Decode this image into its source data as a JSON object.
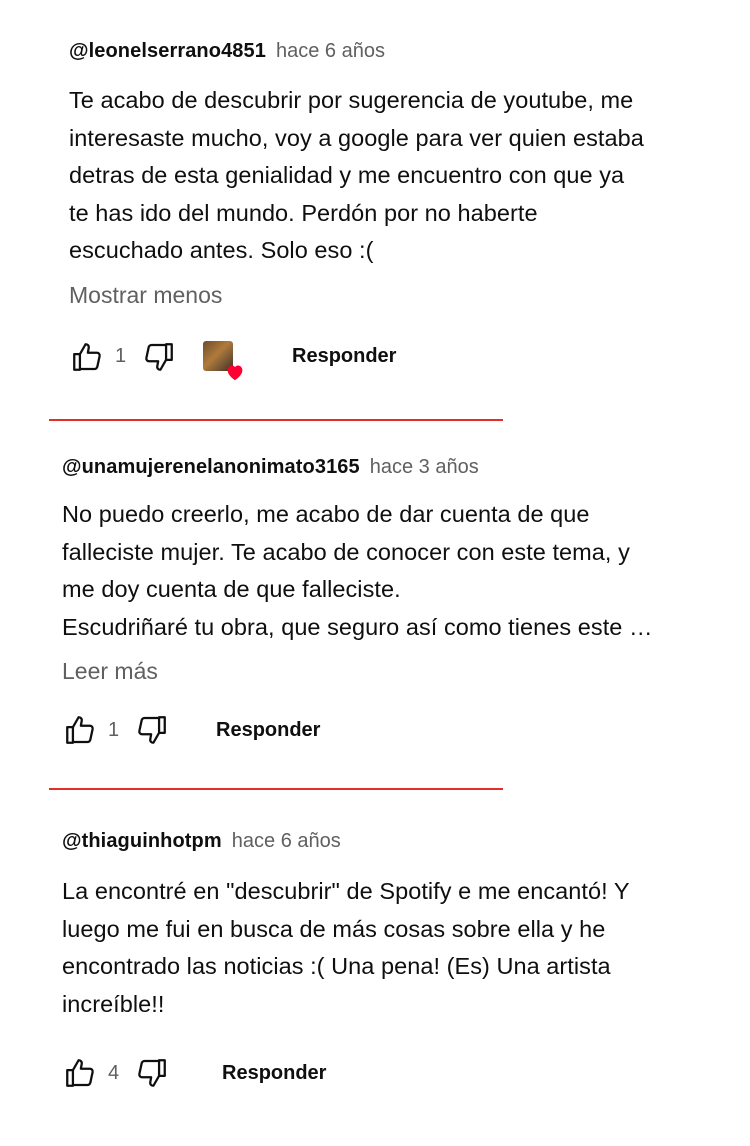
{
  "comments": [
    {
      "author": "@leonelserrano4851",
      "time": "hace 6 años",
      "lines": [
        "Te acabo de descubrir por sugerencia de youtube, me",
        "interesaste mucho, voy a google para ver quien estaba",
        "detras de esta genialidad y me encuentro con que ya",
        "te has ido del mundo. Perdón por no haberte",
        "escuchado antes. Solo eso :("
      ],
      "toggle": "Mostrar menos",
      "likes": "1",
      "reply": "Responder"
    },
    {
      "author": "@unamujerenelanonimato3165",
      "time": "hace 3 años",
      "lines": [
        "No puedo creerlo, me acabo de dar cuenta de que",
        "falleciste mujer. Te acabo de conocer con este tema, y",
        "me doy cuenta de que falleciste.",
        "Escudriñaré tu obra, que seguro así como tienes este …"
      ],
      "toggle": "Leer más",
      "likes": "1",
      "reply": "Responder"
    },
    {
      "author": "@thiaguinhotpm",
      "time": "hace 6 años",
      "lines": [
        "La encontré en \"descubrir\" de Spotify e me encantó! Y",
        "luego me fui en busca de más cosas sobre ella y he",
        "encontrado las noticias :( Una pena! (Es) Una artista",
        "increíble!!"
      ],
      "likes": "4",
      "reply": "Responder"
    }
  ],
  "colors": {
    "divider": "#e0302a",
    "heart": "#ff0033",
    "muted": "#606060"
  },
  "icons": [
    "thumbs-up-icon",
    "thumbs-down-icon",
    "creator-heart-icon"
  ]
}
